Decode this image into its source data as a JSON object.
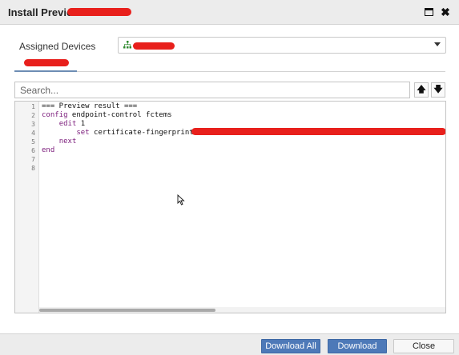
{
  "dialog": {
    "title": "Install Preview of",
    "maximize_icon": "maximize-icon",
    "close_icon_glyph": "✖"
  },
  "assigned": {
    "label": "Assigned Devices",
    "icon": "device-group-icon"
  },
  "search": {
    "placeholder": "Search...",
    "up_glyph": "🡅",
    "down_glyph": "🡇"
  },
  "editor": {
    "line_numbers": [
      "1",
      "2",
      "3",
      "4",
      "5",
      "6",
      "7",
      "8"
    ],
    "lines": [
      {
        "plain": "=== Preview result ==="
      },
      {
        "kw": "config",
        "plain": " endpoint-control fctems"
      },
      {
        "indent": "    ",
        "kw": "edit",
        "plain": " 1"
      },
      {
        "indent": "        ",
        "kw": "set",
        "plain": " certificate-fingerprint ",
        "str": "\""
      },
      {
        "indent": "    ",
        "kw": "next"
      },
      {
        "kw": "end"
      }
    ]
  },
  "footer": {
    "download_all_label": "Download All",
    "download_label": "Download",
    "close_label": "Close"
  },
  "colors": {
    "primary": "#4d79b8",
    "redaction": "#e8201c",
    "keyword": "#7a1a7a"
  }
}
